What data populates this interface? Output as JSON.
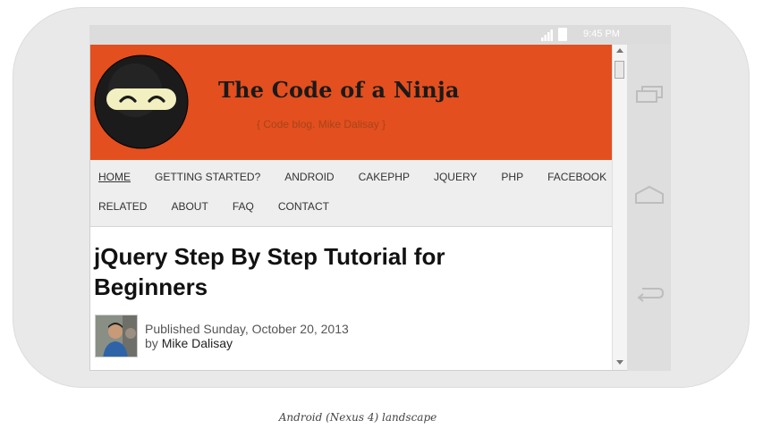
{
  "device": {
    "status_time": "9:45 PM"
  },
  "site": {
    "title": "The Code of a Ninja",
    "tagline": "{ Code blog. Mike Dalisay }",
    "header_color": "#e34f1e"
  },
  "menu": {
    "row1": [
      "HOME",
      "GETTING STARTED?",
      "ANDROID",
      "CAKEPHP",
      "JQUERY",
      "PHP",
      "FACEBOOK"
    ],
    "row2": [
      "RELATED",
      "ABOUT",
      "FAQ",
      "CONTACT"
    ],
    "active": "HOME"
  },
  "post": {
    "title": "jQuery Step By Step Tutorial for Beginners",
    "published": "Published Sunday, October 20, 2013",
    "by_prefix": "by",
    "author": "Mike Dalisay"
  },
  "caption": "Android (Nexus 4) landscape",
  "icons": {
    "logo": "ninja-face-icon",
    "signal": "signal-icon",
    "battery": "battery-icon",
    "recent": "recent-apps-icon",
    "home": "home-icon",
    "back": "back-icon"
  }
}
